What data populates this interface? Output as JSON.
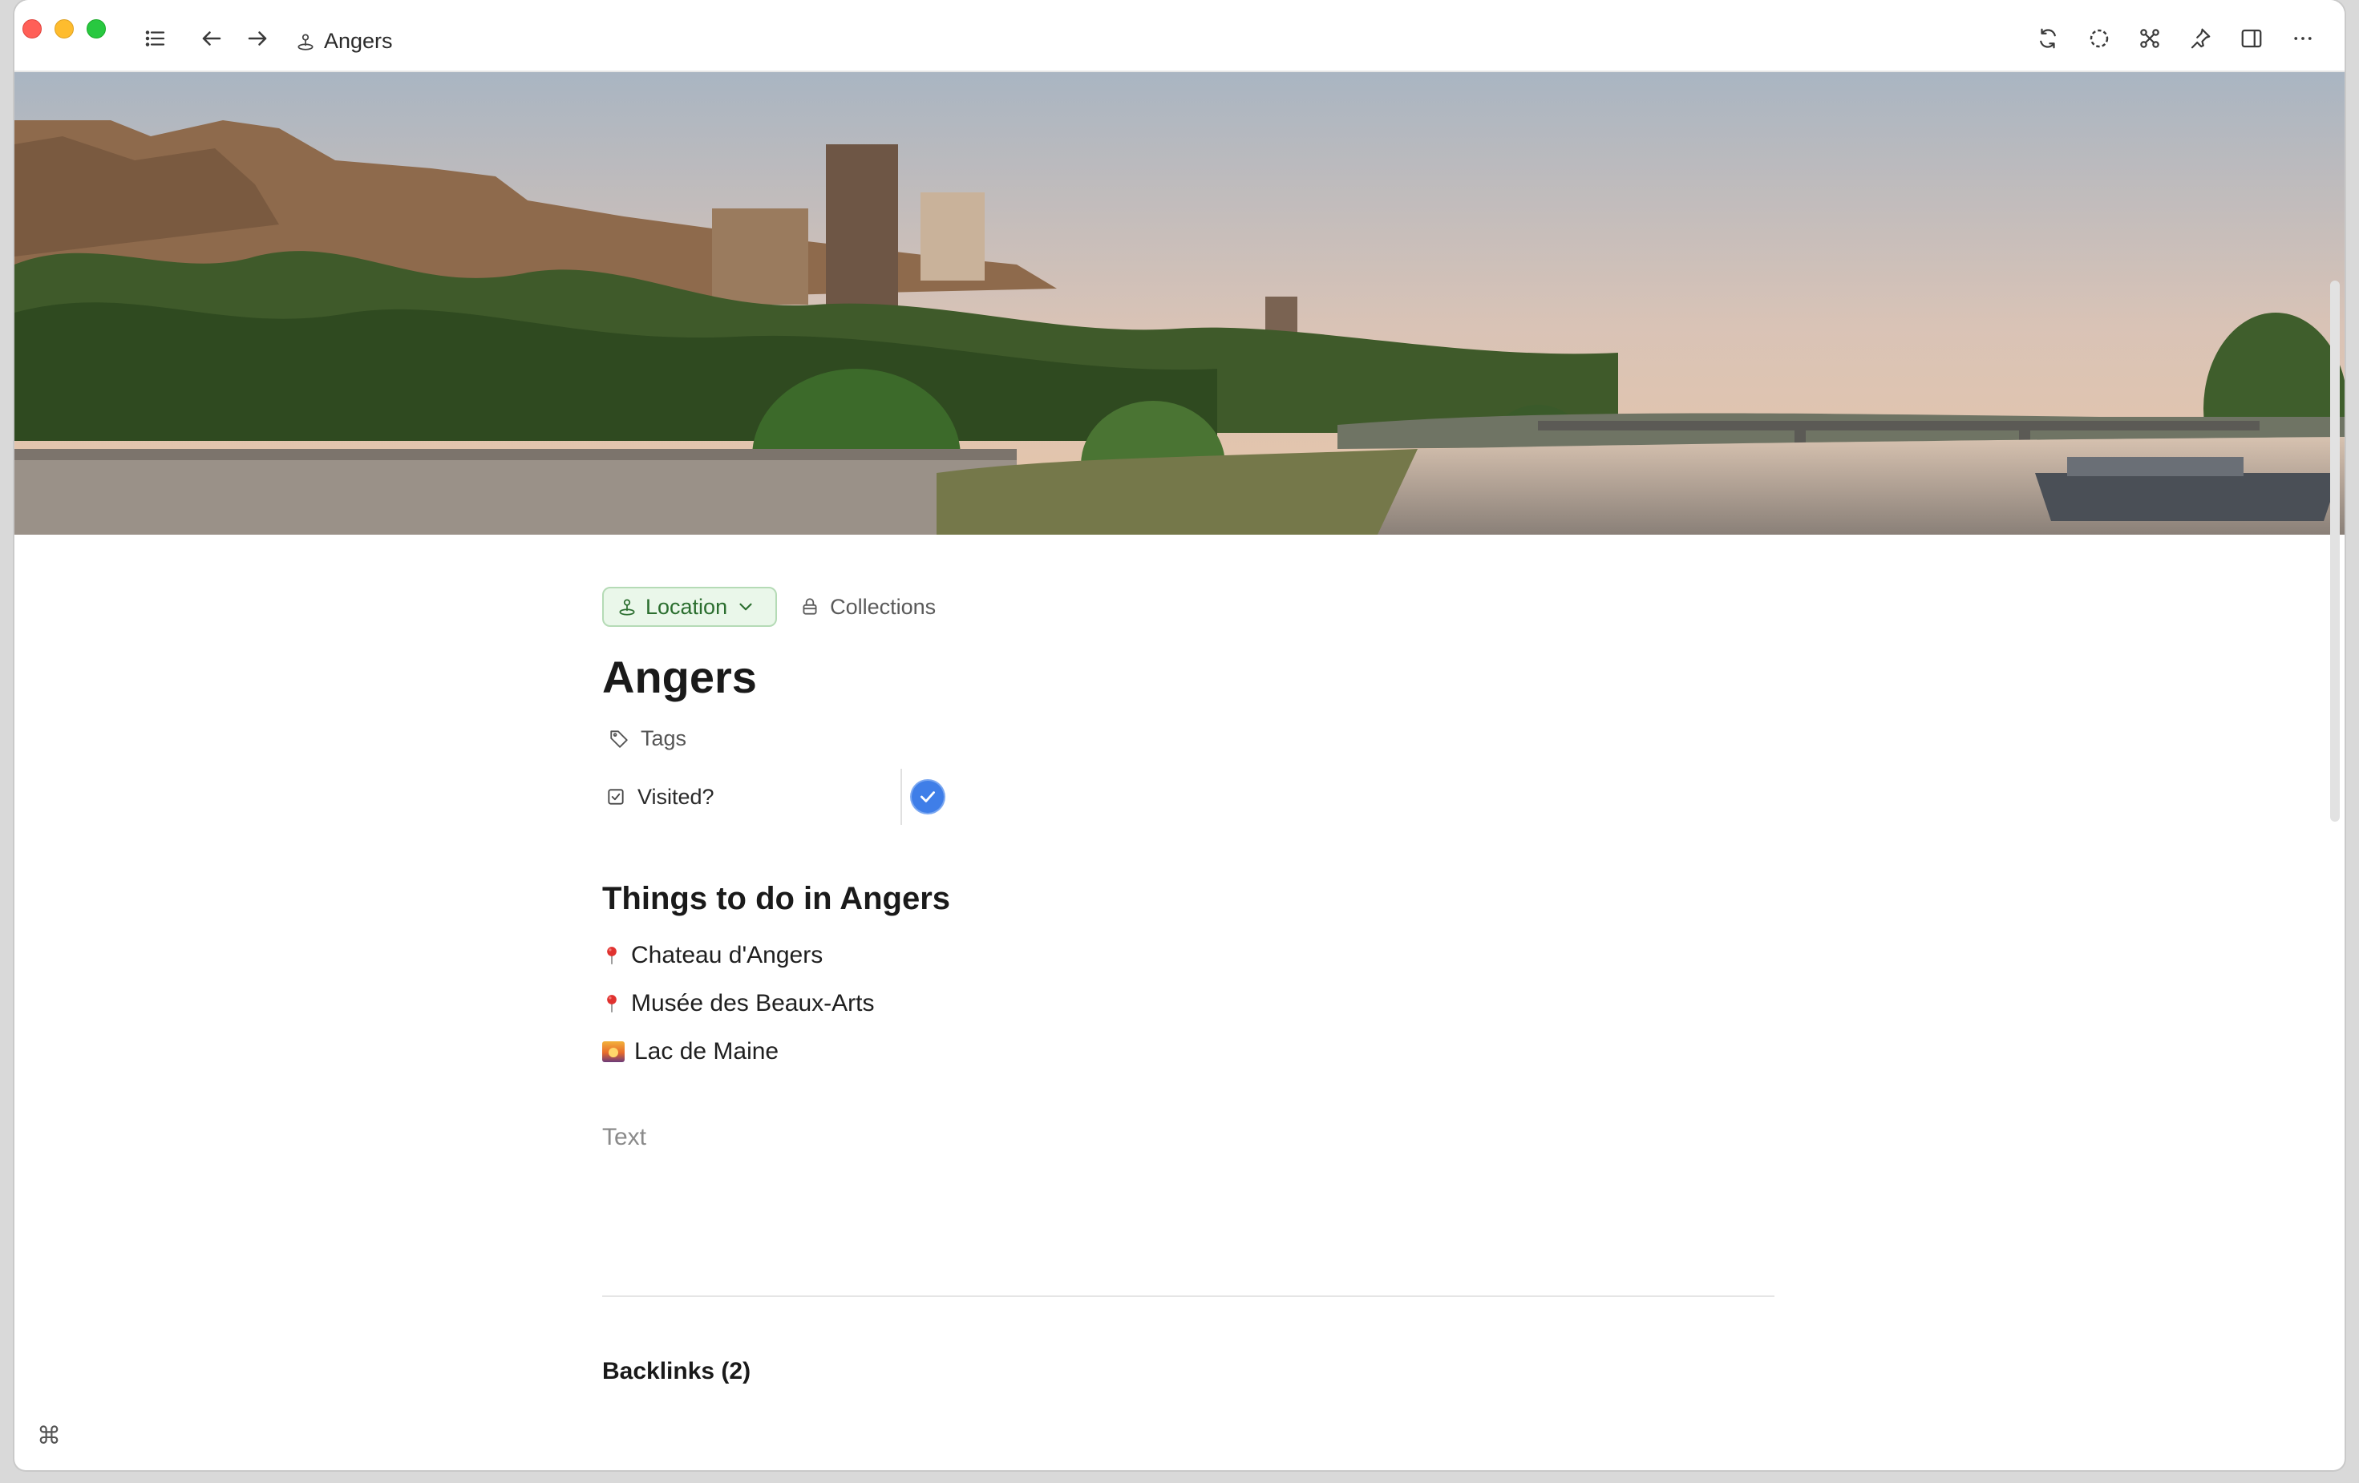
{
  "window": {
    "breadcrumb": "Angers"
  },
  "icons": {
    "sidebar": "list-icon",
    "back": "arrow-left-icon",
    "forward": "arrow-right-icon",
    "location": "location-pin-icon",
    "sync": "sync-icon",
    "status": "dashed-circle-icon",
    "command": "command-icon",
    "pin": "pin-icon",
    "split": "split-view-icon",
    "more": "more-icon",
    "tag": "tag-icon",
    "checkbox": "checkbox-icon",
    "collections": "lock-icon"
  },
  "page": {
    "type_label": "Location",
    "collections_label": "Collections",
    "title": "Angers",
    "tags_label": "Tags",
    "visited_label": "Visited?",
    "visited_checked": true,
    "section_heading": "Things to do in Angers",
    "items": [
      {
        "label": "Chateau d'Angers",
        "icon": "pin-emoji"
      },
      {
        "label": "Musée des Beaux-Arts",
        "icon": "pin-emoji"
      },
      {
        "label": "Lac de Maine",
        "icon": "sunset-emoji"
      }
    ],
    "text_placeholder": "Text",
    "backlinks_label": "Backlinks (2)"
  },
  "footer": {
    "command_glyph": "⌘"
  },
  "colors": {
    "pill_bg": "#eaf7ea",
    "pill_text": "#2b6e2f",
    "checkbox": "#3f7ee8"
  }
}
